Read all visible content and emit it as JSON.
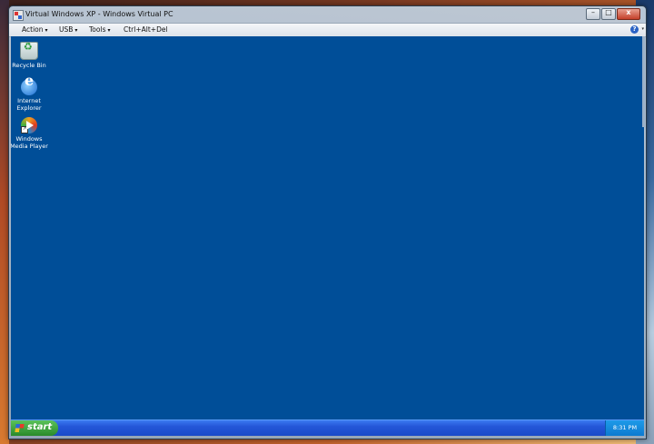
{
  "window": {
    "title": "Virtual Windows XP - Windows Virtual PC",
    "buttons": {
      "minimize": "–",
      "maximize": "□",
      "close": "x"
    }
  },
  "menubar": {
    "items": [
      {
        "label": "Action"
      },
      {
        "label": "USB"
      },
      {
        "label": "Tools"
      },
      {
        "label": "Ctrl+Alt+Del"
      }
    ],
    "dropdown_glyph": "▾",
    "help_glyph": "?"
  },
  "desktop": {
    "background": "#004e98",
    "icons": [
      {
        "label": "Recycle Bin",
        "icon": "recycle-bin-icon"
      },
      {
        "label": "Internet Explorer",
        "icon": "internet-explorer-icon"
      },
      {
        "label": "Windows Media Player",
        "icon": "windows-media-player-icon"
      }
    ]
  },
  "taskbar": {
    "start_label": "start",
    "clock": "8:31 PM",
    "colors": {
      "bar": "#2456d8",
      "start": "#3a9a3a",
      "tray": "#0c7ad0"
    }
  }
}
